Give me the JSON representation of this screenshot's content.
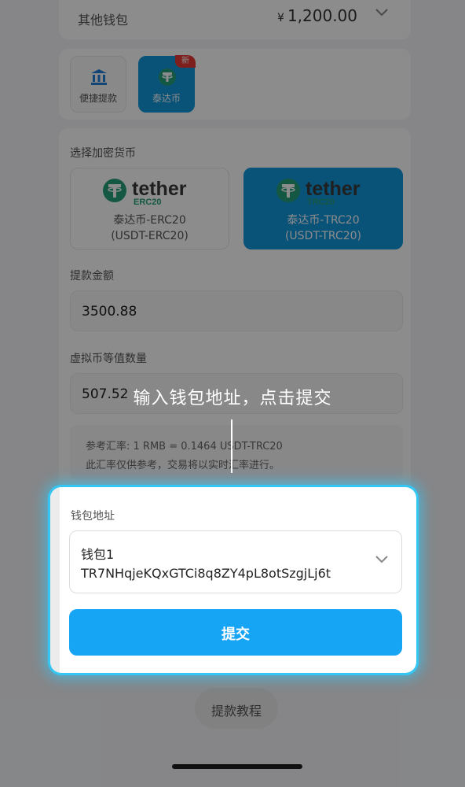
{
  "other_wallet": {
    "label": "其他钱包",
    "currency_symbol": "¥",
    "amount": "1,200.00"
  },
  "methods": [
    {
      "label": "便捷提款",
      "icon": "bank-icon"
    },
    {
      "label": "泰达币",
      "icon": "tether-icon",
      "badge": "新"
    }
  ],
  "crypto": {
    "section_label": "选择加密货币",
    "options": [
      {
        "brand": "tether",
        "network": "ERC20",
        "line1": "泰达币-ERC20",
        "line2": "(USDT-ERC20)"
      },
      {
        "brand": "tether",
        "network": "TRC20",
        "line1": "泰达币-TRC20",
        "line2": "(USDT-TRC20)"
      }
    ],
    "amount_label": "提款金额",
    "amount_value": "3500.88",
    "equivalent_label": "虚拟币等值数量",
    "equivalent_value": "507.52",
    "rate_line": "参考汇率: 1 RMB = 0.1464 USDT-TRC20",
    "rate_note": "此汇率仅供参考，交易将以实时汇率进行。"
  },
  "overlay_tip": "输入钱包地址，点击提交",
  "wallet_address": {
    "label": "钱包地址",
    "wallet_name": "钱包1",
    "address": "TR7NHqjeKQxGTCi8q8ZY4pL8otSzgjLj6t"
  },
  "submit_label": "提交",
  "tutorial_label": "提款教程",
  "colors": {
    "accent": "#16a4f4",
    "tether_green": "#26a17b",
    "highlight": "#35c6f4",
    "badge_red": "#e53935"
  }
}
